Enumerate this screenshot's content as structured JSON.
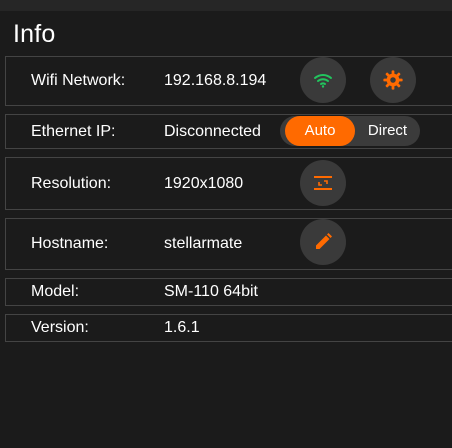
{
  "header": {
    "title": "Info"
  },
  "rows": {
    "wifi": {
      "label": "Wifi Network:",
      "value": "192.168.8.194"
    },
    "ethernet": {
      "label": "Ethernet IP:",
      "value": "Disconnected"
    },
    "resolution": {
      "label": "Resolution:",
      "value": "1920x1080"
    },
    "hostname": {
      "label": "Hostname:",
      "value": "stellarmate"
    },
    "model": {
      "label": "Model:",
      "value": "SM-110 64bit"
    },
    "version": {
      "label": "Version:",
      "value": "1.6.1"
    }
  },
  "ethernet_mode": {
    "options": [
      "Auto",
      "Direct"
    ],
    "selected": "Auto"
  },
  "icons": {
    "wifi_button": "wifi-icon",
    "wifi_settings_button": "gear-icon",
    "resolution_button": "resize-icon",
    "hostname_button": "pencil-icon"
  },
  "colors": {
    "accent": "#ff6a00",
    "wifi_signal": "#22c55e",
    "background": "#1b1b1b",
    "button_bg": "#3a3a3a",
    "border": "#444444"
  }
}
